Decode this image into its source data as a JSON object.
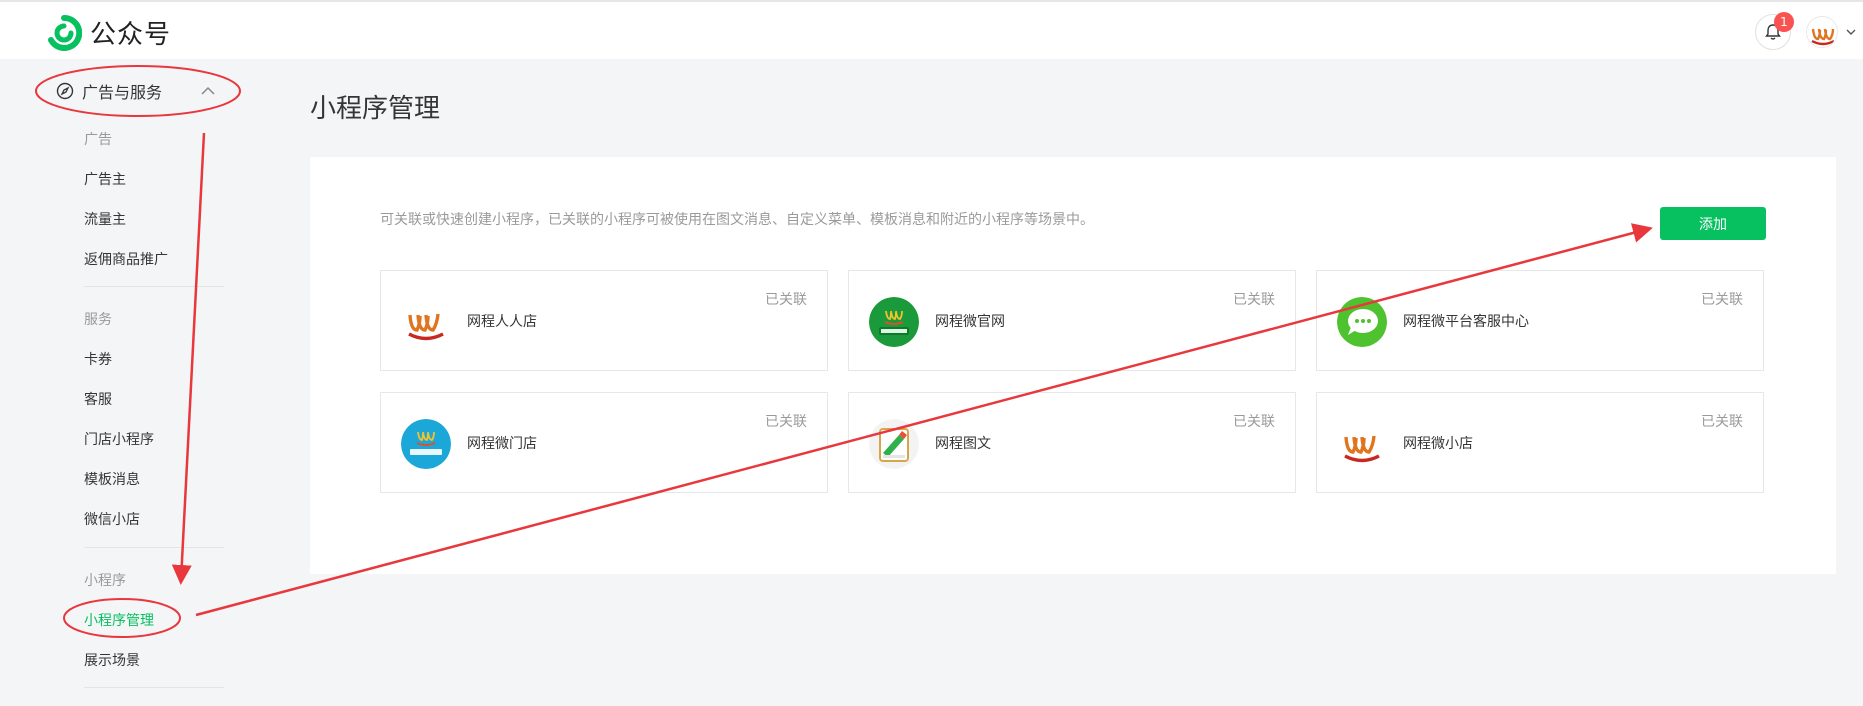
{
  "header": {
    "app_title": "公众号",
    "notification_count": "1"
  },
  "sidebar": {
    "group_label": "广告与服务",
    "sections": [
      {
        "title": "广告",
        "items": [
          "广告主",
          "流量主",
          "返佣商品推广"
        ]
      },
      {
        "title": "服务",
        "items": [
          "卡券",
          "客服",
          "门店小程序",
          "模板消息",
          "微信小店"
        ]
      },
      {
        "title": "小程序",
        "items": [
          "小程序管理",
          "展示场景"
        ]
      }
    ],
    "active_item": "小程序管理"
  },
  "main": {
    "title": "小程序管理",
    "description": "可关联或快速创建小程序，已关联的小程序可被使用在图文消息、自定义菜单、模板消息和附近的小程序等场景中。",
    "add_label": "添加",
    "cards": [
      {
        "name": "网程人人店",
        "status": "已关联",
        "icon": "wcheng-logo-icon"
      },
      {
        "name": "网程微官网",
        "status": "已关联",
        "icon": "green-official-site-icon"
      },
      {
        "name": "网程微平台客服中心",
        "status": "已关联",
        "icon": "chat-bubble-icon"
      },
      {
        "name": "网程微门店",
        "status": "已关联",
        "icon": "blue-store-icon"
      },
      {
        "name": "网程图文",
        "status": "已关联",
        "icon": "edit-document-icon"
      },
      {
        "name": "网程微小店",
        "status": "已关联",
        "icon": "wcheng-logo-icon"
      }
    ]
  },
  "colors": {
    "accent": "#07c160",
    "annotation": "#e8383d",
    "badge": "#fa5151"
  }
}
